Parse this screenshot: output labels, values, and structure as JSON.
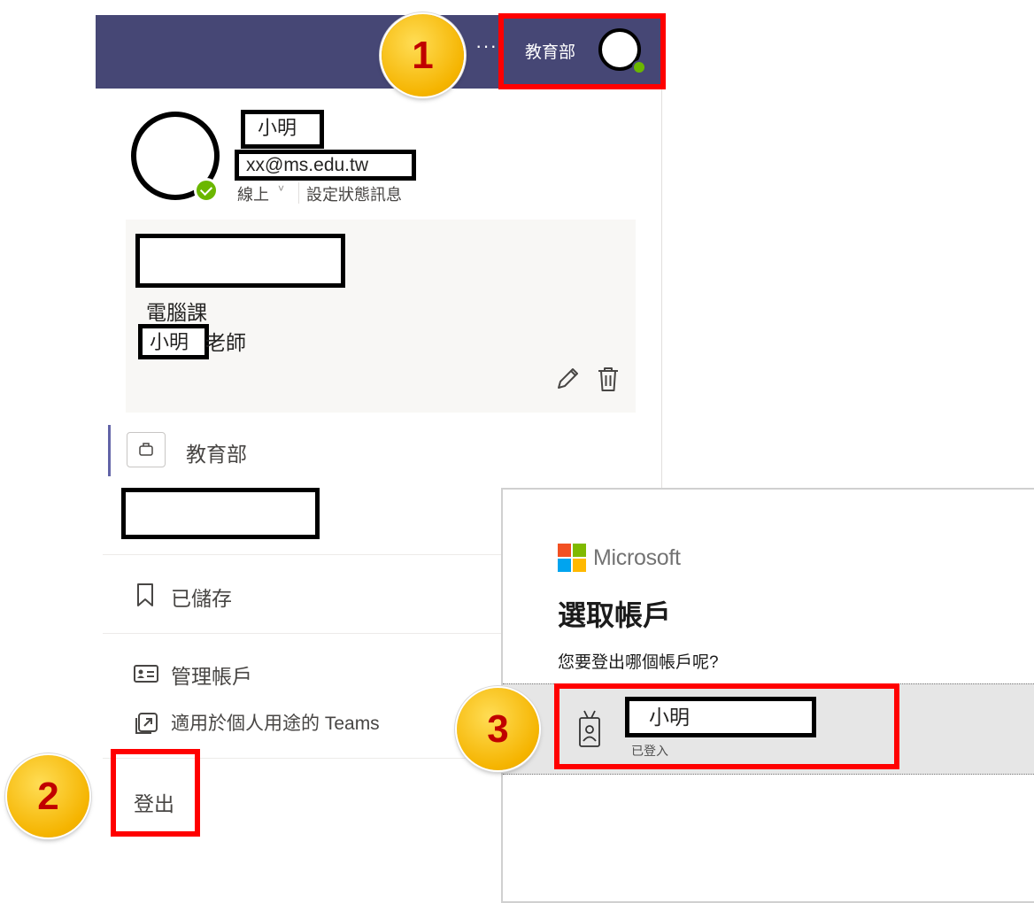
{
  "teams_header": {
    "more_options_label": "···",
    "org_name": "教育部"
  },
  "profile": {
    "name": "小明",
    "email": "xx@ms.edu.tw",
    "status": "線上",
    "status_chevron": "˅",
    "set_status_message": "設定狀態訊息",
    "presence_color": "#6bb700"
  },
  "class_card": {
    "subject": "電腦課",
    "teacher_name": "小明",
    "teacher_suffix": "老師"
  },
  "orgs": [
    {
      "label": "教育部",
      "active": true
    }
  ],
  "menu": {
    "saved_label": "已儲存",
    "manage_account_label": "管理帳戶",
    "personal_teams_label": "適用於個人用途的 Teams",
    "sign_out_label": "登出"
  },
  "account_picker": {
    "brand": "Microsoft",
    "title": "選取帳戶",
    "prompt": "您要登出哪個帳戶呢?",
    "accounts": [
      {
        "name": "小明",
        "status": "已登入"
      }
    ]
  },
  "annotations": {
    "steps": [
      "1",
      "2",
      "3"
    ],
    "highlight_color": "#ff0000",
    "step_color": "#f5b400"
  },
  "colors": {
    "teams_header": "#464775",
    "teams_accent": "#6264a7"
  },
  "icons": [
    "more-icon",
    "avatar",
    "presence-icon",
    "edit-icon",
    "delete-icon",
    "briefcase-icon",
    "bookmark-icon",
    "contact-card-icon",
    "open-external-icon",
    "microsoft-logo-icon",
    "badge-icon"
  ]
}
